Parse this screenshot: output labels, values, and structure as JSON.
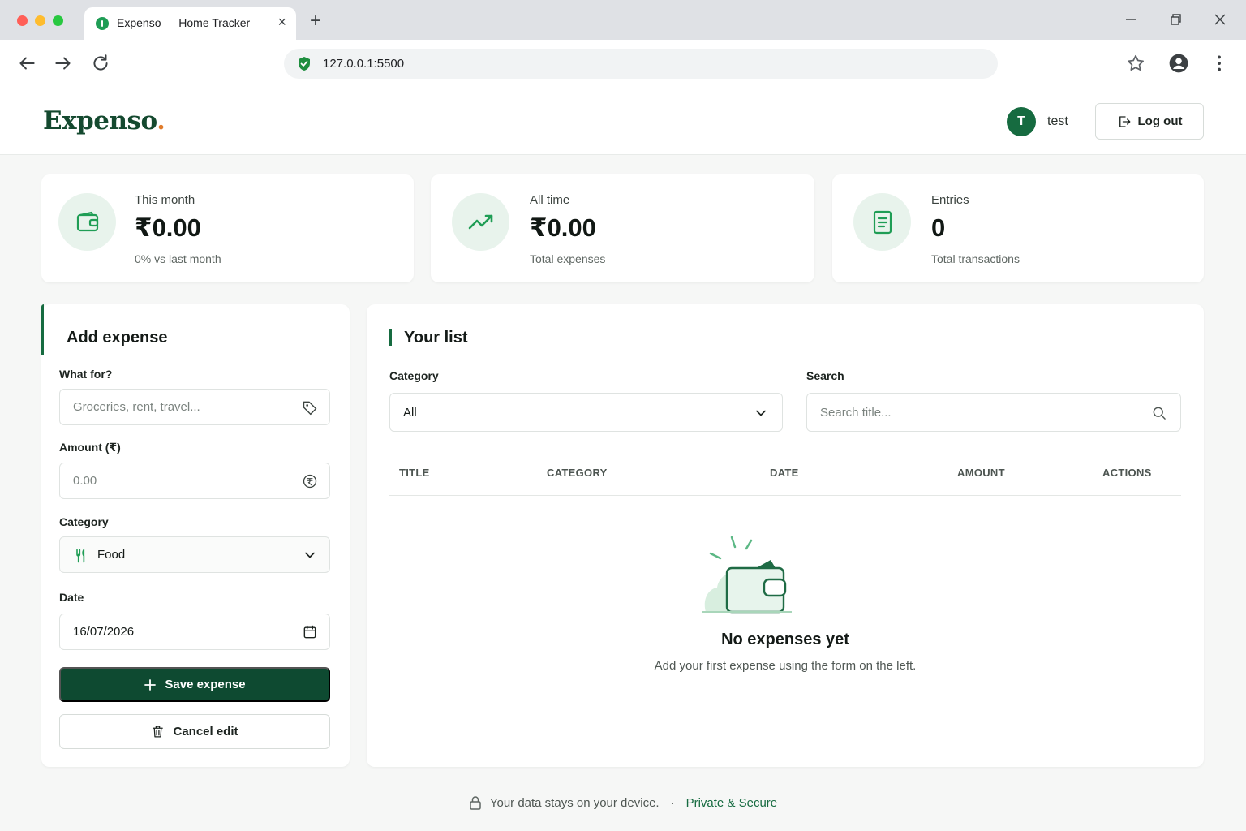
{
  "browser": {
    "tab_title": "Expenso — Home Tracker",
    "url": "127.0.0.1:5500",
    "icons": [
      "back-icon",
      "forward-icon",
      "reload-icon",
      "star-icon",
      "profile-icon",
      "menu-icon"
    ]
  },
  "header": {
    "logo": "Expenso",
    "logo_dot": ".",
    "avatar_initial": "T",
    "username": "test",
    "logout_label": "Log out"
  },
  "stats": [
    {
      "label": "This month",
      "value": "₹0.00",
      "sub": "0% vs last month",
      "icon": "wallet-icon"
    },
    {
      "label": "All time",
      "value": "₹0.00",
      "sub": "Total expenses",
      "icon": "trending-up-icon"
    },
    {
      "label": "Entries",
      "value": "0",
      "sub": "Total transactions",
      "icon": "receipt-icon"
    }
  ],
  "add_form": {
    "title": "Add expense",
    "what_label": "What for?",
    "what_placeholder": "Groceries, rent, travel...",
    "amount_label": "Amount (₹)",
    "amount_placeholder": "0.00",
    "category_label": "Category",
    "category_value": "Food",
    "date_label": "Date",
    "date_value": "16/07/2026",
    "save_label": "Save expense",
    "cancel_label": "Cancel edit"
  },
  "list": {
    "title": "Your list",
    "category_label": "Category",
    "category_value": "All",
    "search_label": "Search",
    "search_placeholder": "Search title...",
    "columns": [
      "TITLE",
      "CATEGORY",
      "DATE",
      "AMOUNT",
      "ACTIONS"
    ],
    "rows": [],
    "empty_title": "No expenses yet",
    "empty_sub": "Add your first expense using the form on the left."
  },
  "footer": {
    "text": "Your data stays on your device.",
    "separator": "·",
    "secure": "Private & Secure"
  },
  "colors": {
    "brand_green": "#0e4a31",
    "accent_green": "#166b40",
    "logo_dot": "#e07b2a",
    "icon_bg": "#e8f3ec"
  }
}
